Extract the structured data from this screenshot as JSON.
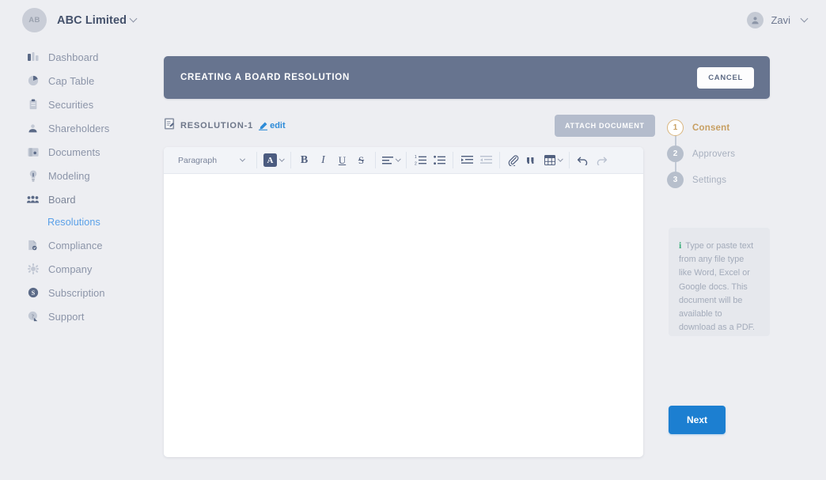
{
  "header": {
    "org_initials": "AB",
    "org_name": "ABC Limited",
    "user_name": "Zavi"
  },
  "sidebar": {
    "items": [
      {
        "label": "Dashboard",
        "icon": "dashboard-icon",
        "active": false
      },
      {
        "label": "Cap Table",
        "icon": "pie-chart-icon",
        "active": false
      },
      {
        "label": "Securities",
        "icon": "clipboard-icon",
        "active": false
      },
      {
        "label": "Shareholders",
        "icon": "person-icon",
        "active": false
      },
      {
        "label": "Documents",
        "icon": "folder-icon",
        "active": false
      },
      {
        "label": "Modeling",
        "icon": "lightbulb-icon",
        "active": false
      },
      {
        "label": "Board",
        "icon": "people-group-icon",
        "active": false
      }
    ],
    "sub_item": {
      "label": "Resolutions",
      "active": true
    },
    "items_lower": [
      {
        "label": "Compliance",
        "icon": "document-check-icon"
      },
      {
        "label": "Company",
        "icon": "building-icon"
      },
      {
        "label": "Subscription",
        "icon": "dollar-circle-icon"
      },
      {
        "label": "Support",
        "icon": "question-circle-icon"
      }
    ]
  },
  "banner": {
    "title": "CREATING A BOARD RESOLUTION",
    "cancel_label": "CANCEL",
    "background": "#67748f"
  },
  "document": {
    "name": "RESOLUTION-1",
    "edit_label": "edit",
    "attach_label": "ATTACH DOCUMENT",
    "body_text": ""
  },
  "toolbar": {
    "block_format": "Paragraph",
    "buttons": [
      {
        "name": "text-color-button",
        "glyph": "A",
        "state": "active"
      },
      {
        "name": "bold-button",
        "glyph": "B",
        "state": "normal"
      },
      {
        "name": "italic-button",
        "glyph": "I",
        "state": "normal"
      },
      {
        "name": "underline-button",
        "glyph": "U",
        "state": "normal"
      },
      {
        "name": "strikethrough-button",
        "glyph": "S",
        "state": "normal"
      },
      {
        "name": "align-button",
        "glyph": "align",
        "state": "normal"
      },
      {
        "name": "ordered-list-button",
        "glyph": "1.",
        "state": "normal"
      },
      {
        "name": "bullet-list-button",
        "glyph": "•",
        "state": "normal"
      },
      {
        "name": "indent-button",
        "glyph": "indent",
        "state": "normal"
      },
      {
        "name": "outdent-button",
        "glyph": "outdent",
        "state": "dim"
      },
      {
        "name": "link-button",
        "glyph": "link",
        "state": "normal"
      },
      {
        "name": "quote-button",
        "glyph": "““",
        "state": "normal"
      },
      {
        "name": "table-button",
        "glyph": "table",
        "state": "normal"
      },
      {
        "name": "undo-button",
        "glyph": "↩",
        "state": "normal"
      },
      {
        "name": "redo-button",
        "glyph": "↪",
        "state": "dim"
      }
    ]
  },
  "stepper": {
    "steps": [
      {
        "number": "1",
        "label": "Consent",
        "state": "active"
      },
      {
        "number": "2",
        "label": "Approvers",
        "state": "idle"
      },
      {
        "number": "3",
        "label": "Settings",
        "state": "idle"
      }
    ],
    "active_color": "#c79f62",
    "idle_color": "#b7bfcc"
  },
  "info": {
    "text": "Type or paste text from any file type like Word, Excel or Google docs. This document will be available to download as a PDF.",
    "icon_color": "#3fae7d"
  },
  "footer": {
    "next_label": "Next",
    "next_color": "#1c7fd1"
  }
}
